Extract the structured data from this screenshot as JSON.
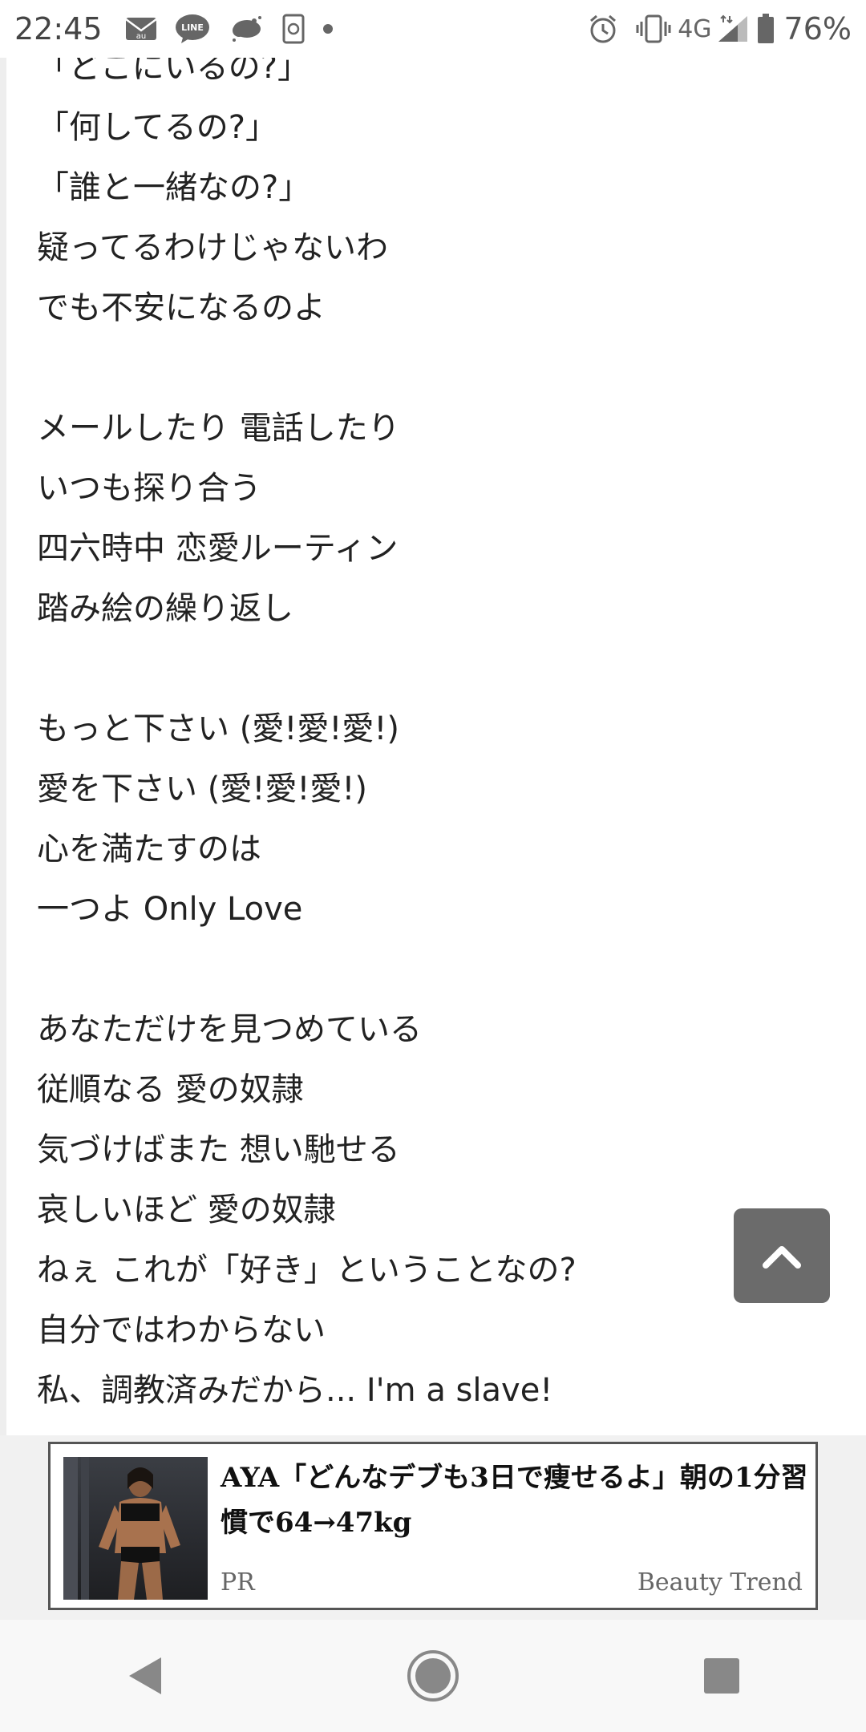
{
  "status_bar": {
    "time": "22:45",
    "network": "4G",
    "battery": "76%",
    "notification_icons": [
      "au-mail-icon",
      "line-icon",
      "weather-icon",
      "clipboard-icon",
      "dot-icon"
    ],
    "system_icons": [
      "alarm-icon",
      "vibrate-icon",
      "signal-icon",
      "battery-icon"
    ],
    "line_icon_text": "LINE",
    "au_text": "au"
  },
  "lyrics": {
    "lines": [
      "「どこにいるの?」",
      "「何してるの?」",
      "「誰と一緒なの?」",
      "疑ってるわけじゃないわ",
      "でも不安になるのよ",
      "",
      "メールしたり 電話したり",
      "いつも探り合う",
      "四六時中 恋愛ルーティン",
      "踏み絵の繰り返し",
      "",
      "もっと下さい (愛!愛!愛!)",
      "愛を下さい (愛!愛!愛!)",
      "心を満たすのは",
      "一つよ Only Love",
      "",
      "あなただけを見つめている",
      "従順なる 愛の奴隷",
      "気づけばまた 想い馳せる",
      "哀しいほど 愛の奴隷",
      "ねぇ これが「好き」ということなの?",
      "自分ではわからない",
      "私、調教済みだから... I'm a slave!"
    ]
  },
  "scroll_top_button": {
    "icon": "chevron-up-icon"
  },
  "ad": {
    "title": "AYA「どんなデブも3日で痩せるよ」朝の1分習慣で64→47kg",
    "label": "PR",
    "source": "Beauty Trend"
  },
  "nav": {
    "icons": [
      "back-icon",
      "home-icon",
      "recents-icon"
    ]
  },
  "colors": {
    "background": "#ffffff",
    "text": "#222222",
    "top_button": "#6b6b6b",
    "ad_band": "#f1f1f1",
    "ad_border": "#555555"
  }
}
